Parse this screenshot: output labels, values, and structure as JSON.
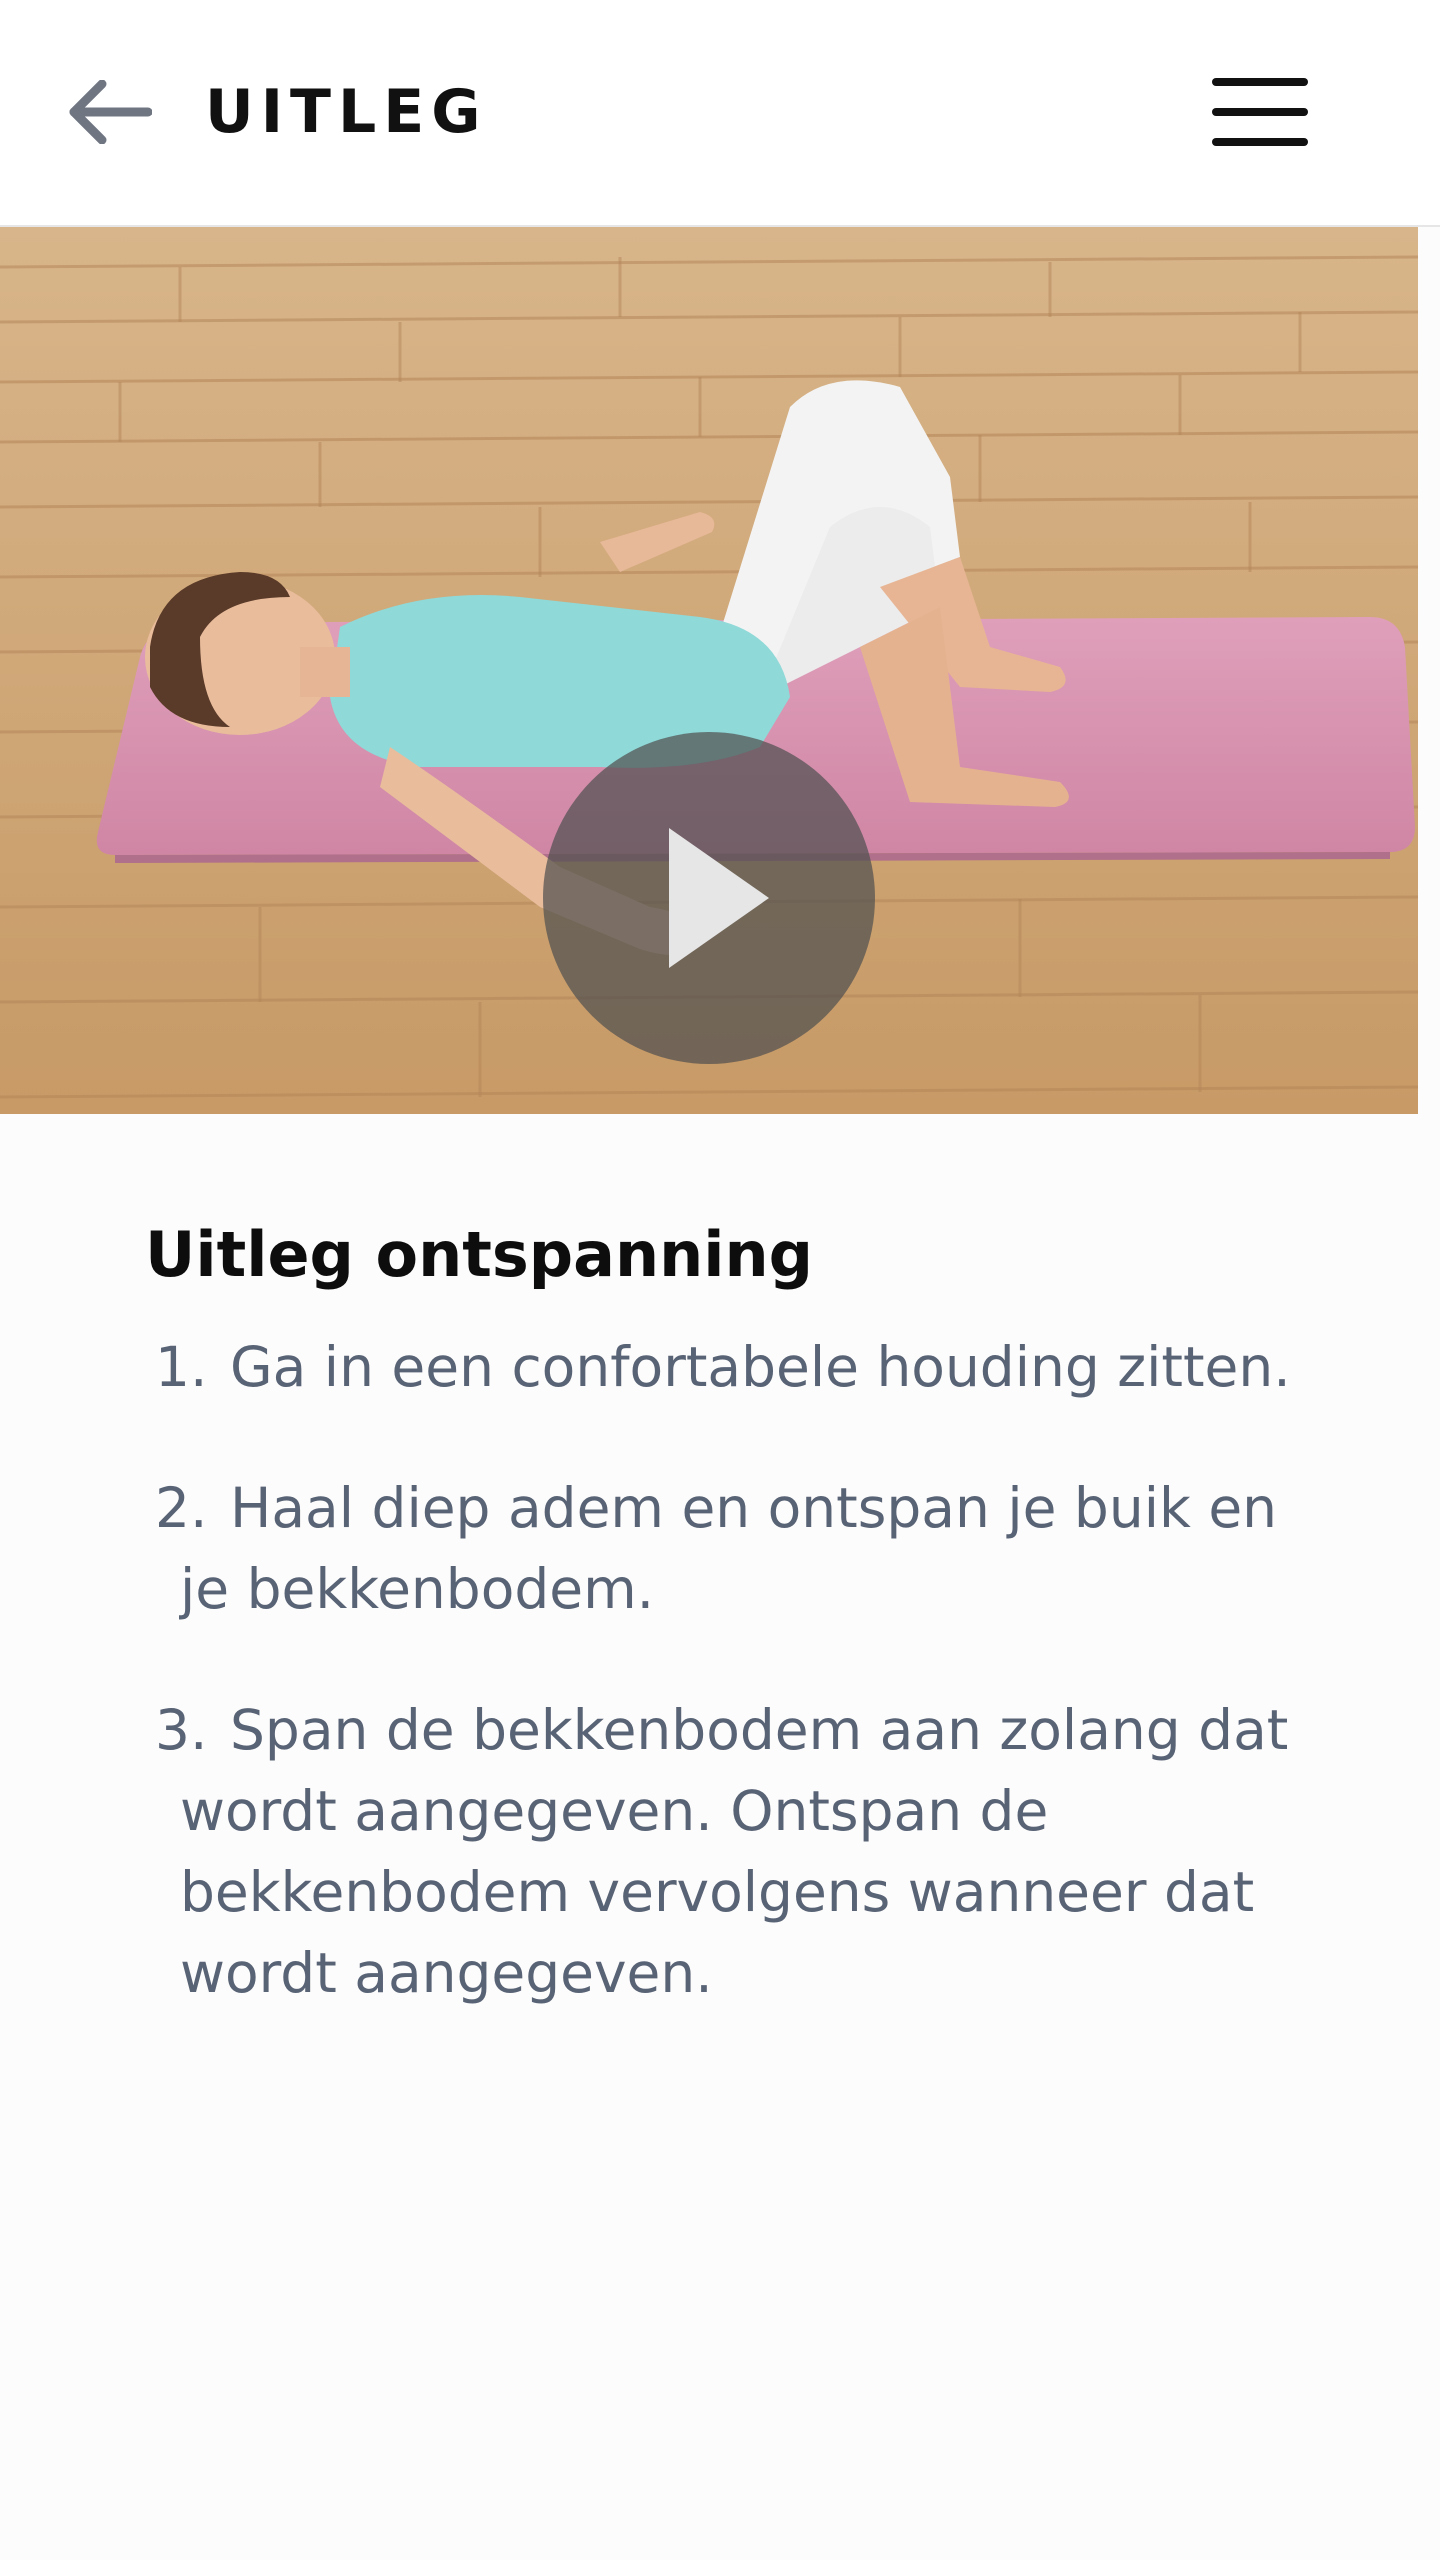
{
  "header": {
    "title": "UITLEG",
    "back_icon": "arrow-left-icon",
    "menu_icon": "hamburger-menu-icon"
  },
  "video": {
    "play_icon": "play-icon"
  },
  "content": {
    "title": "Uitleg ontspanning",
    "steps": [
      {
        "number": "1.",
        "text": "Ga in een confortabele houding zitten."
      },
      {
        "number": "2.",
        "text": "Haal diep adem en ontspan je buik en je bekkenbodem."
      },
      {
        "number": "3.",
        "text": "Span de bekkenbodem aan zolang dat wordt aangegeven. Ontspan de bekkenbodem vervolgens wanneer dat wordt aangegeven."
      }
    ]
  },
  "colors": {
    "header_bg": "#ffffff",
    "title_text": "#111111",
    "body_text": "#586375",
    "back_arrow": "#6f7682",
    "play_overlay": "#505050"
  }
}
